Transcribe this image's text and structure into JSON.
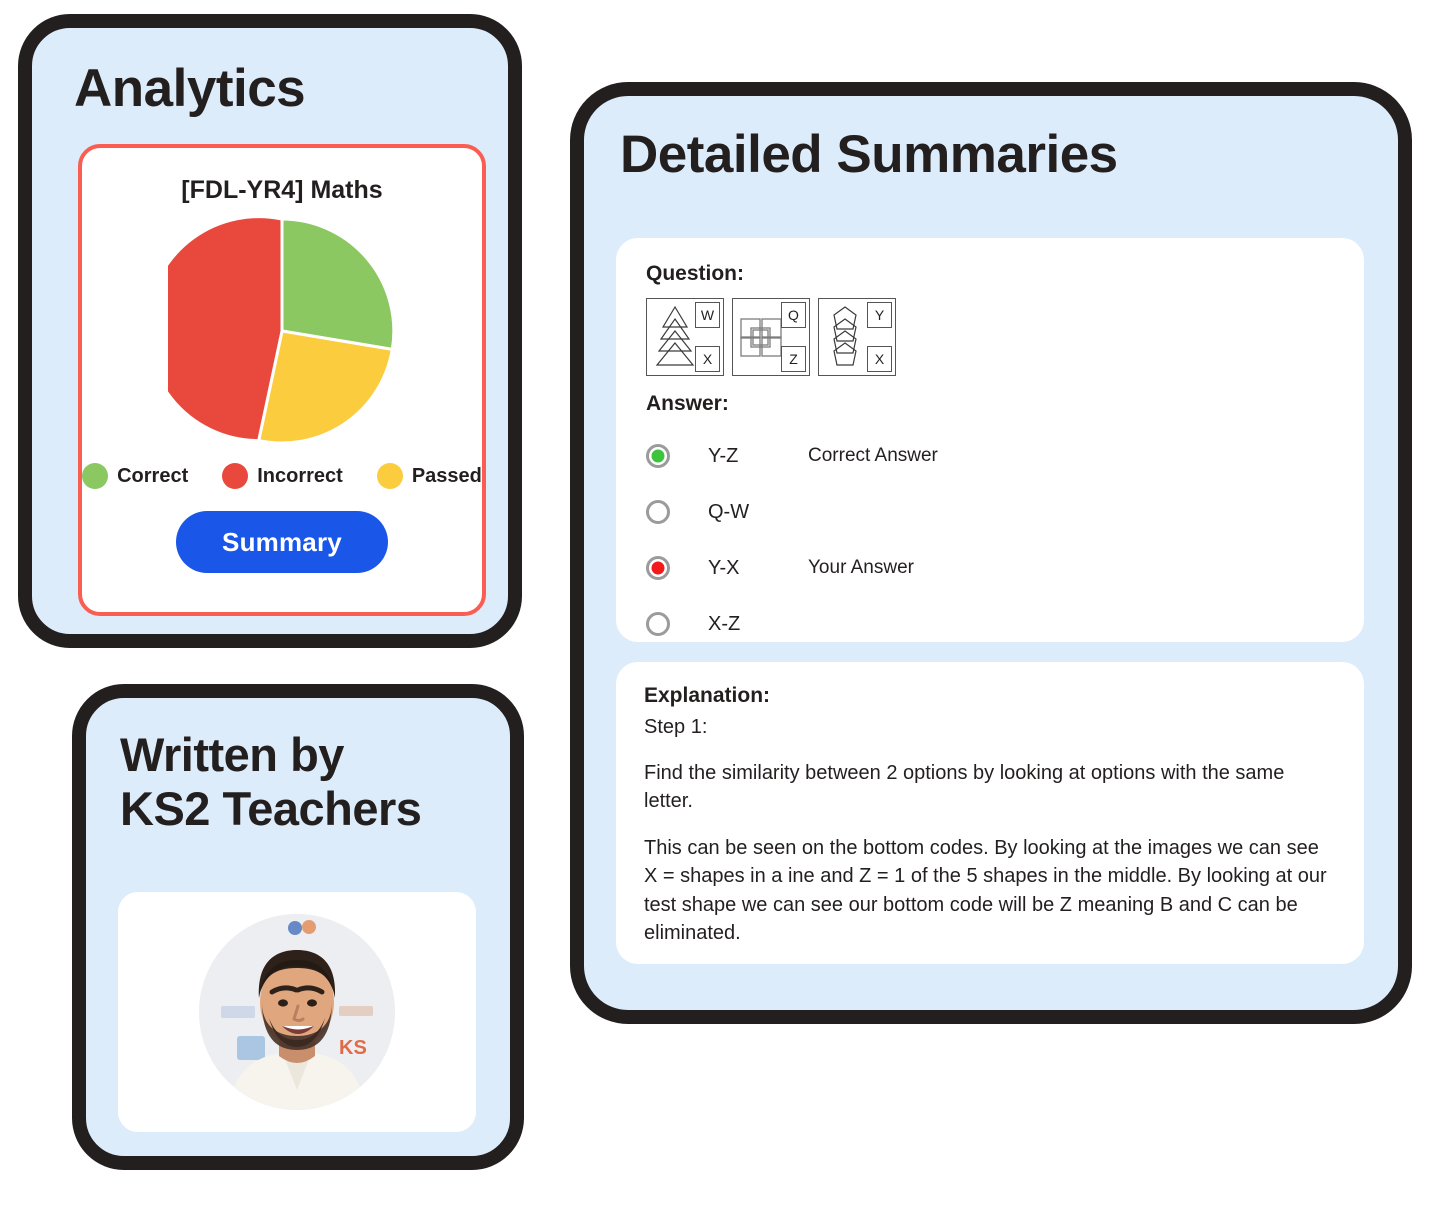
{
  "analytics": {
    "title": "Analytics",
    "chart_title": "[FDL-YR4] Maths",
    "summary_button": "Summary"
  },
  "written_by": {
    "title_line1": "Written by",
    "title_line2": "KS2 Teachers",
    "avatar_alt": "teacher-portrait"
  },
  "summaries": {
    "title": "Detailed Summaries",
    "question_label": "Question:",
    "answer_label": "Answer:",
    "explanation_label": "Explanation:",
    "step_label": "Step 1:",
    "figures": [
      {
        "art": "triangles-stack",
        "top_code": "W",
        "bottom_code": "X"
      },
      {
        "art": "overlapping-squares",
        "top_code": "Q",
        "bottom_code": "Z"
      },
      {
        "art": "pentagons-stack",
        "top_code": "Y",
        "bottom_code": "X"
      }
    ],
    "answers": [
      {
        "code": "Y-Z",
        "note": "Correct Answer",
        "state": "correct"
      },
      {
        "code": "Q-W",
        "note": "",
        "state": "empty"
      },
      {
        "code": "Y-X",
        "note": "Your Answer",
        "state": "yours"
      },
      {
        "code": "X-Z",
        "note": "",
        "state": "empty"
      }
    ],
    "explanation_paragraph_1": "Find the similarity between 2 options by looking at options with the same letter.",
    "explanation_paragraph_2": "This can be seen on the bottom codes. By looking at the images we can see X = shapes in a ine and Z = 1 of the  5 shapes in the middle. By looking at our test shape we can see our bottom code will be Z meaning B and C can be eliminated."
  },
  "colors": {
    "correct_green": "#8bc862",
    "incorrect_red": "#e8493c",
    "passed_yellow": "#fbcd3e",
    "card_blue": "#ddecfb",
    "outline_black": "#231f1f",
    "accent_coral": "#fa5d51",
    "button_blue": "#1a56e8"
  },
  "chart_data": {
    "type": "pie",
    "title": "[FDL-YR4] Maths",
    "categories": [
      "Correct",
      "Incorrect",
      "Passed"
    ],
    "values": [
      27,
      47,
      26
    ],
    "colors": [
      "#8bc862",
      "#e8493c",
      "#fbcd3e"
    ],
    "start_angle_deg": 0,
    "direction": "clockwise",
    "legend_position": "bottom",
    "slice_angles_deg": [
      100,
      168,
      92
    ],
    "labels": [
      "Correct",
      "Incorrect",
      "Passed"
    ]
  }
}
